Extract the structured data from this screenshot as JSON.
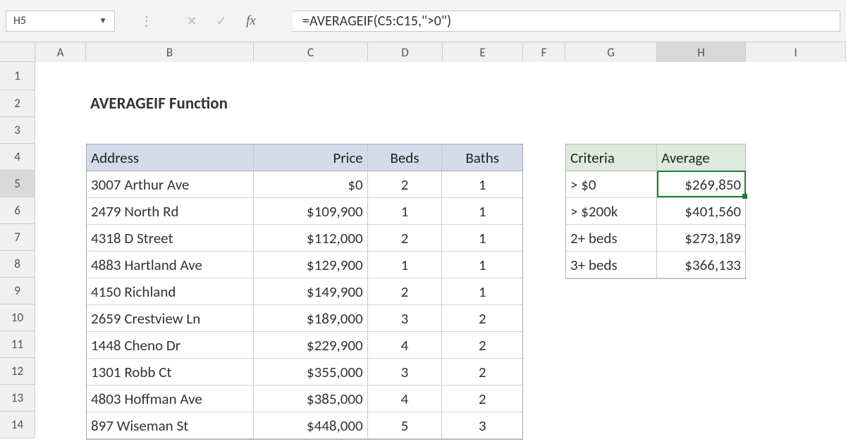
{
  "formula_bar": {
    "cell_ref": "H5",
    "formula": "=AVERAGEIF(C5:C15,\">0\")"
  },
  "columns": [
    "A",
    "B",
    "C",
    "D",
    "E",
    "F",
    "G",
    "H",
    "I"
  ],
  "title_cell": "AVERAGEIF Function",
  "main_table": {
    "headers": [
      "Address",
      "Price",
      "Beds",
      "Baths"
    ],
    "rows": [
      [
        "3007 Arthur Ave",
        "$0",
        "2",
        "1"
      ],
      [
        "2479 North Rd",
        "$109,900",
        "1",
        "1"
      ],
      [
        "4318 D Street",
        "$112,000",
        "2",
        "1"
      ],
      [
        "4883 Hartland Ave",
        "$129,900",
        "1",
        "1"
      ],
      [
        "4150 Richland",
        "$149,900",
        "2",
        "1"
      ],
      [
        "2659 Crestview Ln",
        "$189,000",
        "3",
        "2"
      ],
      [
        "1448 Cheno Dr",
        "$229,900",
        "4",
        "2"
      ],
      [
        "1301 Robb Ct",
        "$355,000",
        "3",
        "2"
      ],
      [
        "4803 Hoffman Ave",
        "$385,000",
        "4",
        "2"
      ],
      [
        "897 Wiseman St",
        "$448,000",
        "5",
        "3"
      ]
    ]
  },
  "criteria_table": {
    "headers": [
      "Criteria",
      "Average"
    ],
    "rows": [
      [
        "> $0",
        "$269,850"
      ],
      [
        "> $200k",
        "$401,560"
      ],
      [
        "2+ beds",
        "$273,189"
      ],
      [
        "3+ beds",
        "$366,133"
      ]
    ]
  },
  "row_numbers": [
    "1",
    "2",
    "3",
    "4",
    "5",
    "6",
    "7",
    "8",
    "9",
    "10",
    "11",
    "12",
    "13",
    "14"
  ],
  "selected": {
    "col": "H",
    "row": "5"
  }
}
